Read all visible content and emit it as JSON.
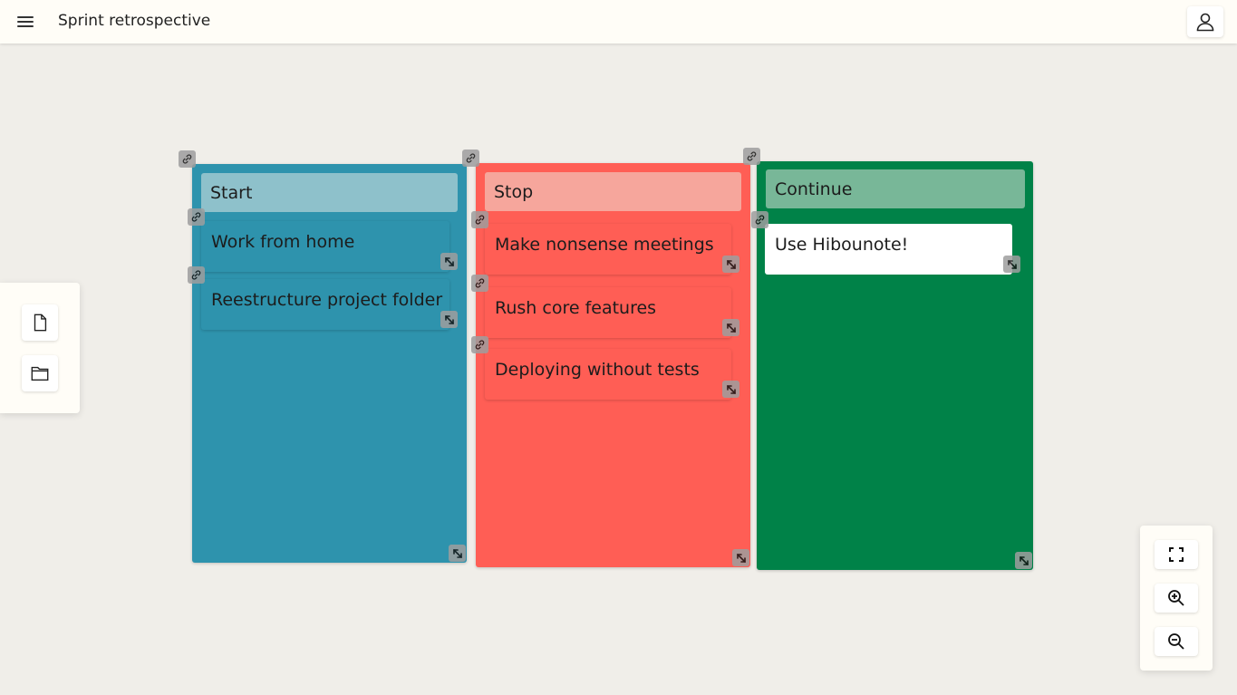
{
  "header": {
    "title": "Sprint retrospective",
    "menu_icon": "hamburger-menu-icon",
    "user_icon": "user-icon"
  },
  "sidebar": {
    "tools": [
      {
        "icon": "new-file-icon"
      },
      {
        "icon": "open-folder-icon"
      }
    ]
  },
  "zoom_controls": {
    "buttons": [
      {
        "icon": "fullscreen-icon"
      },
      {
        "icon": "zoom-in-icon"
      },
      {
        "icon": "zoom-out-icon"
      }
    ]
  },
  "board": {
    "columns": [
      {
        "title": "Start",
        "color": "#2e93ad",
        "title_color": "#8ec1cb",
        "cards": [
          "Work from home",
          "Reestructure project folder"
        ]
      },
      {
        "title": "Stop",
        "color": "#ff5e55",
        "title_color": "#f6a69c",
        "cards": [
          "Make nonsense meetings",
          "Rush core features",
          "Deploying without tests"
        ]
      },
      {
        "title": "Continue",
        "color": "#008248",
        "title_color": "#78b798",
        "cards": [
          "Use Hibounote!"
        ]
      }
    ]
  },
  "icons": {
    "link": "link-icon",
    "resize": "resize-icon"
  }
}
